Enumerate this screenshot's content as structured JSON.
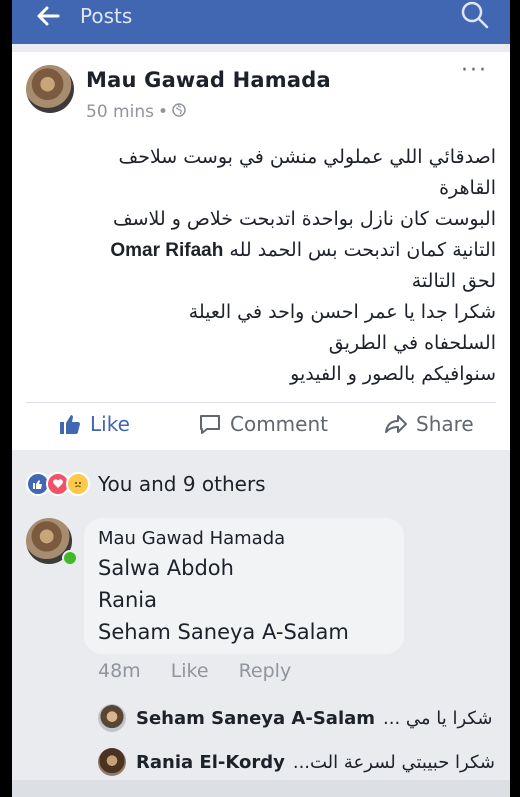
{
  "topbar": {
    "title": "Posts",
    "back_icon": "back-arrow-icon",
    "search_icon": "search-icon"
  },
  "post": {
    "author": "Mau Gawad Hamada",
    "time": "50 mins",
    "separator": "•",
    "privacy_icon": "globe-icon",
    "more_label": "···",
    "lines": [
      "اصدقائي اللي عملولي منشن في بوست سلاحف",
      "القاهرة",
      "البوست كان نازل بواحدة اتدبحت خلاص و للاسف",
      "التانية كمان اتدبحت بس الحمد لله",
      "لحق التالتة",
      "شكرا جدا يا عمر احسن واحد في العيلة",
      "السلحفاه في الطريق",
      "سنوافيكم بالصور و الفيديو"
    ],
    "mention": "Omar Rifaah"
  },
  "actions": {
    "like": "Like",
    "comment": "Comment",
    "share": "Share"
  },
  "reactions": {
    "text": "You and 9 others",
    "colors": {
      "like": "#4267b2",
      "love": "#f25268",
      "sad": "#fcc94b"
    }
  },
  "comment": {
    "author": "Mau Gawad Hamada",
    "lines": [
      "Salwa Abdoh",
      "Rania",
      "Seham Saneya A-Salam"
    ],
    "time": "48m",
    "like": "Like",
    "reply": "Reply"
  },
  "replies": [
    {
      "name": "Seham Saneya A-Salam",
      "text": "شكرا يا مي ..."
    },
    {
      "name": "Rania El-Kordy",
      "text": "شكرا حبيبتي لسرعة الت..."
    }
  ],
  "colors": {
    "brand": "#4267b2",
    "background": "#e9ebee"
  }
}
